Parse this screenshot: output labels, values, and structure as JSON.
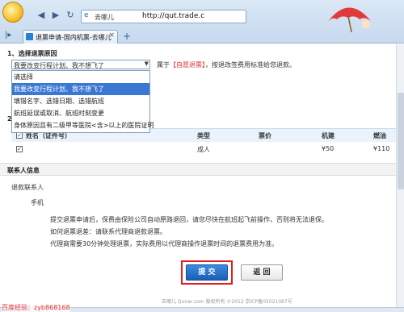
{
  "browser": {
    "address_domain": "去哪儿",
    "address_url": "http://qut.trade.c",
    "tab_title": "退票申请-国内机票-去哪儿",
    "new_tab": "+",
    "close": "×"
  },
  "section1": {
    "title": "1、选择退票原因",
    "selected": "我要改变行程计划、我不想飞了",
    "hint_prefix": "属于",
    "hint_red": "【自愿退票】",
    "hint_suffix": "，按退改签费用标准给您退款。",
    "options": [
      "请选择",
      "我要改变行程计划、我不想飞了",
      "填错名字、选错日期、选错航班",
      "航班延误或取消、航班时刻变更",
      "身体原因且有二级甲等医院<含>以上的医院证明"
    ]
  },
  "section2": {
    "number": "2",
    "headers": [
      "姓名（证件号）",
      "类型",
      "票价",
      "机建",
      "燃油"
    ],
    "row": {
      "type": "成人",
      "price": "",
      "tax": "¥50",
      "fuel": "¥110"
    }
  },
  "contact": {
    "title": "联系人信息",
    "refund_contact": "退款联系人",
    "phone_label": "手机",
    "notes": [
      "提交退票申请后，保费由保险公司自动原路退回，请您尽快在航班起飞前操作，否则将无法退保。",
      "如何退票退差：请联系代理商退款退票。",
      "代理商需要30分钟处理退票，实际费用以代理商操作退票时间的退票费用为准。"
    ]
  },
  "buttons": {
    "submit": "提 交",
    "back": "返 回"
  },
  "footer": "去哪儿 Qunar.com 版权所有 ©2012 京ICP备05021087号",
  "caption": "百度经验：zyb868168"
}
